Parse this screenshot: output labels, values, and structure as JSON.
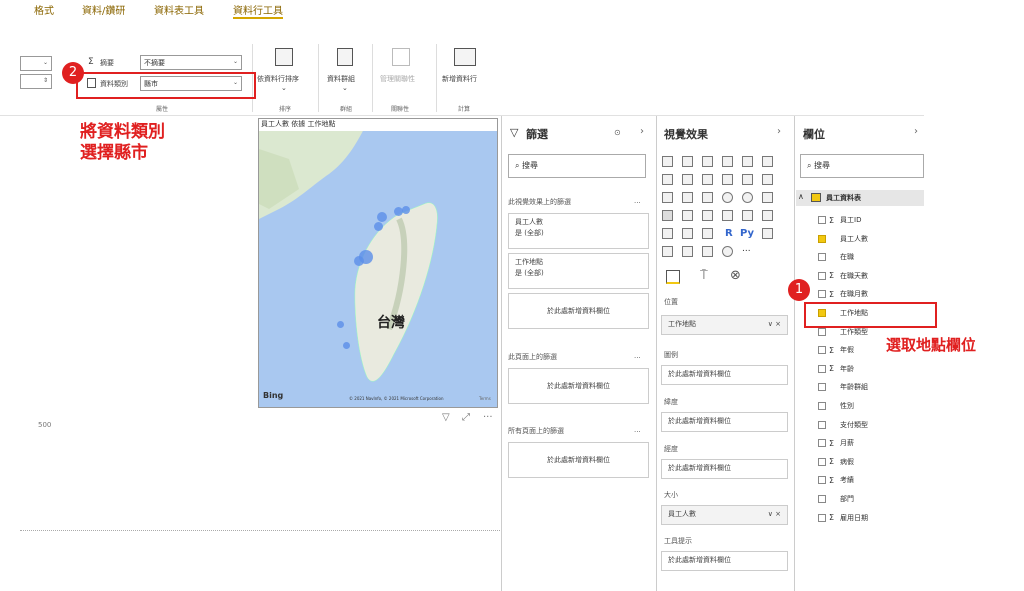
{
  "ribbon": {
    "tabs": [
      "格式",
      "資料/鑽研",
      "資料表工具",
      "資料行工具"
    ],
    "summarize_label": "摘要",
    "summarize_value": "不摘要",
    "category_label": "資料類別",
    "category_value": "縣市",
    "sort_label": "依資料行排序",
    "group_label": "資料群組",
    "manage_rel_label": "管理關聯性",
    "new_col_label": "新增資料行",
    "groups": {
      "properties": "屬性",
      "sort": "排序",
      "groups": "群組",
      "relations": "關聯性",
      "calc": "計算"
    }
  },
  "annotations": {
    "step1_number": "1",
    "step2_number": "2",
    "callout_left_line1": "將資料類別",
    "callout_left_line2": "選擇縣市",
    "callout_right": "選取地點欄位"
  },
  "canvas": {
    "axis_label": "500"
  },
  "map_visual": {
    "title": "員工人數 依據 工作地點",
    "country_label": "台灣",
    "bing_label": "Bing",
    "copyright": "© 2021 NavInfo, © 2021 Microsoft Corporation",
    "terms": "Terms"
  },
  "filters_pane": {
    "title": "篩選",
    "search_placeholder": "搜尋",
    "visual_filters_label": "此視覺效果上的篩選",
    "filter1_name": "員工人數",
    "filter1_value": "是 (全部)",
    "filter2_name": "工作地點",
    "filter2_value": "是 (全部)",
    "add_field": "於此處新增資料欄位",
    "page_filters_label": "此頁面上的篩選",
    "all_pages_label": "所有頁面上的篩選",
    "more": "..."
  },
  "viz_pane": {
    "title": "視覺效果",
    "r_label": "R",
    "py_label": "Py",
    "ellipsis": "...",
    "location_label": "位置",
    "location_value": "工作地點",
    "legend_label": "圖例",
    "latitude_label": "緯度",
    "longitude_label": "經度",
    "size_label": "大小",
    "size_value": "員工人數",
    "tooltip_label": "工具提示",
    "add_field": "於此處新增資料欄位",
    "clear": "∨ ×"
  },
  "fields_pane": {
    "title": "欄位",
    "search_placeholder": "搜尋",
    "table_name": "員工資料表",
    "fields": [
      {
        "sigma": "Σ",
        "name": "員工ID",
        "checked": false
      },
      {
        "sigma": "",
        "name": "員工人數",
        "checked": true
      },
      {
        "sigma": "",
        "name": "在職",
        "checked": false
      },
      {
        "sigma": "Σ",
        "name": "在職天數",
        "checked": false
      },
      {
        "sigma": "Σ",
        "name": "在職月數",
        "checked": false
      },
      {
        "sigma": "",
        "name": "工作地點",
        "checked": true
      },
      {
        "sigma": "",
        "name": "工作類型",
        "checked": false
      },
      {
        "sigma": "Σ",
        "name": "年假",
        "checked": false
      },
      {
        "sigma": "Σ",
        "name": "年齡",
        "checked": false
      },
      {
        "sigma": "",
        "name": "年齡群組",
        "checked": false
      },
      {
        "sigma": "",
        "name": "性別",
        "checked": false
      },
      {
        "sigma": "",
        "name": "支付類型",
        "checked": false
      },
      {
        "sigma": "Σ",
        "name": "月薪",
        "checked": false
      },
      {
        "sigma": "Σ",
        "name": "病假",
        "checked": false
      },
      {
        "sigma": "Σ",
        "name": "考績",
        "checked": false
      },
      {
        "sigma": "",
        "name": "部門",
        "checked": false
      },
      {
        "sigma": "Σ",
        "name": "雇用日期",
        "checked": false
      }
    ]
  },
  "colors": {
    "accent": "#f2c811",
    "annotation_red": "#e02020",
    "map_water": "#a9c8f0",
    "map_bubble": "#5b8ee8"
  }
}
